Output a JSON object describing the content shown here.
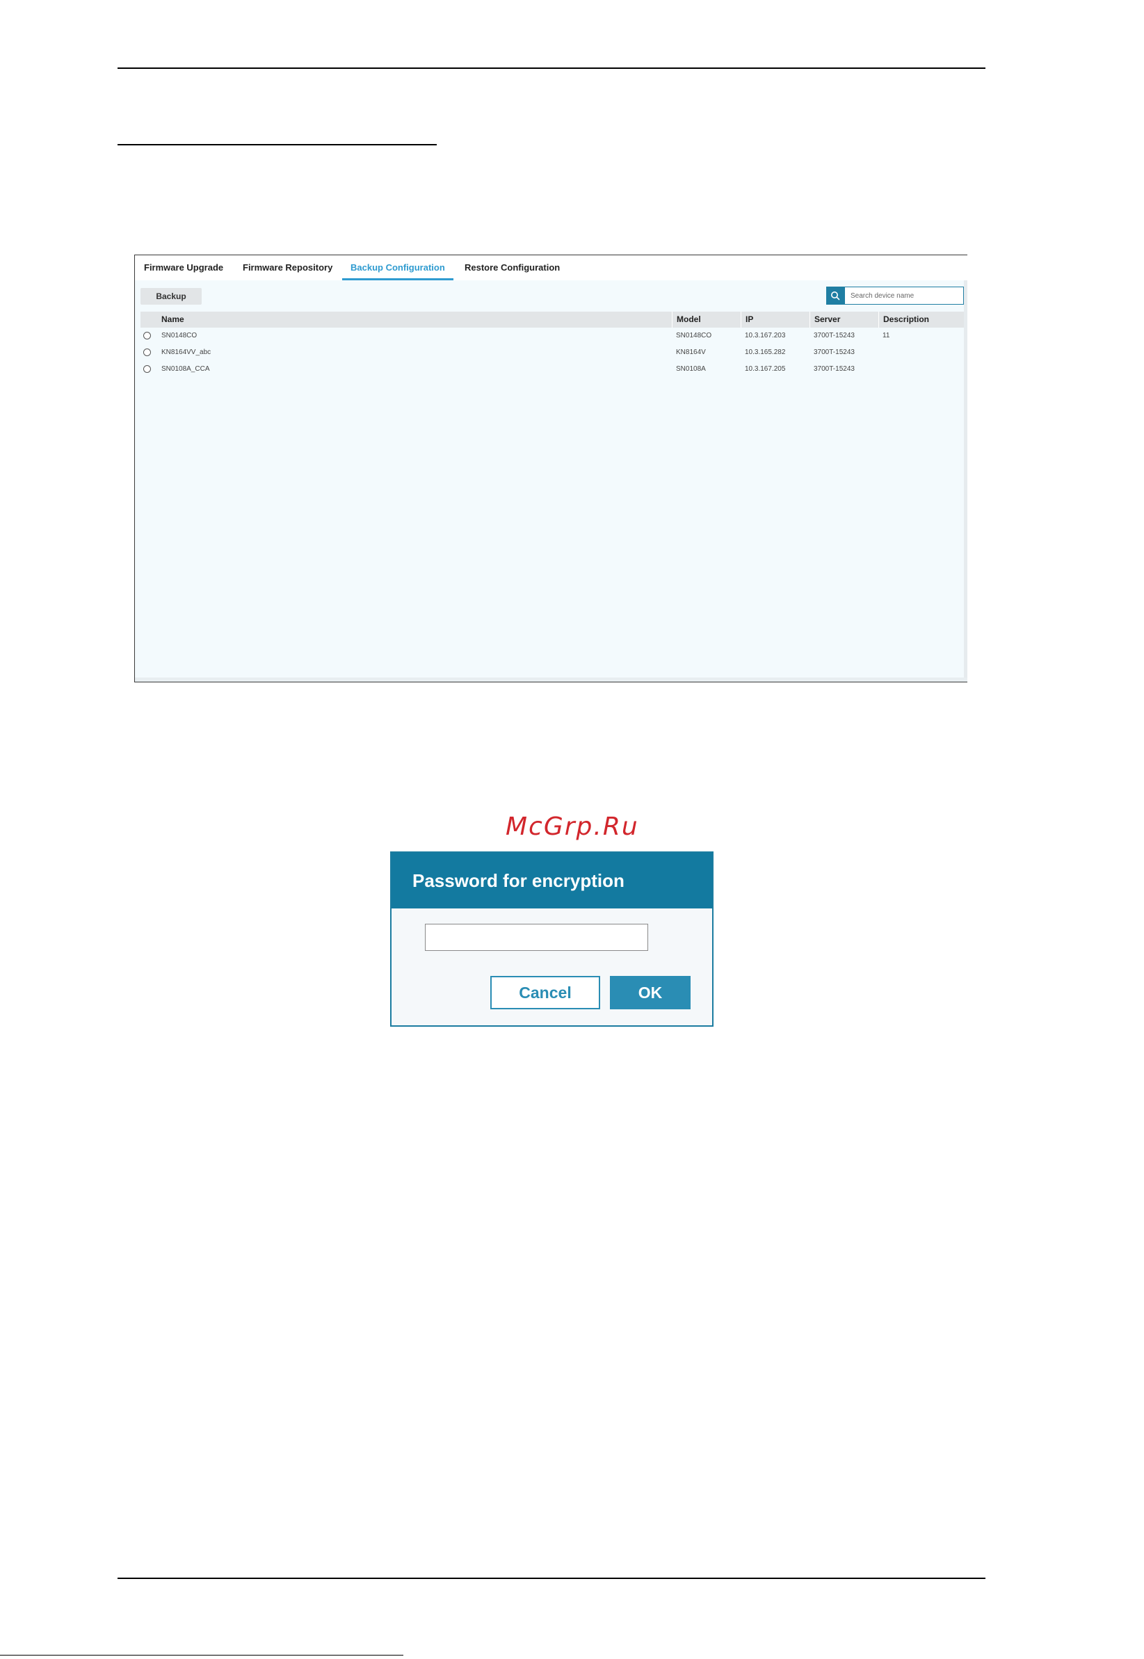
{
  "tabs": [
    {
      "label": "Firmware Upgrade",
      "active": false
    },
    {
      "label": "Firmware Repository",
      "active": false
    },
    {
      "label": "Backup Configuration",
      "active": true
    },
    {
      "label": "Restore Configuration",
      "active": false
    }
  ],
  "toolbar": {
    "backup_label": "Backup",
    "search_placeholder": "Search device name",
    "search_icon": "search-icon"
  },
  "table": {
    "columns": [
      "Name",
      "Model",
      "IP",
      "Server",
      "Description"
    ],
    "rows": [
      {
        "name": "SN0148CO",
        "model": "SN0148CO",
        "ip": "10.3.167.203",
        "server": "3700T-15243",
        "description": "11"
      },
      {
        "name": "KN8164VV_abc",
        "model": "KN8164V",
        "ip": "10.3.165.282",
        "server": "3700T-15243",
        "description": ""
      },
      {
        "name": "SN0108A_CCA",
        "model": "SN0108A",
        "ip": "10.3.167.205",
        "server": "3700T-15243",
        "description": ""
      }
    ]
  },
  "watermark": "McGrp.Ru",
  "dialog": {
    "title": "Password for encryption",
    "cancel_label": "Cancel",
    "ok_label": "OK"
  },
  "colors": {
    "accent": "#2f9bd0",
    "dialog_header": "#137aa0",
    "button_primary": "#2a8db4",
    "watermark": "#d2262c"
  }
}
